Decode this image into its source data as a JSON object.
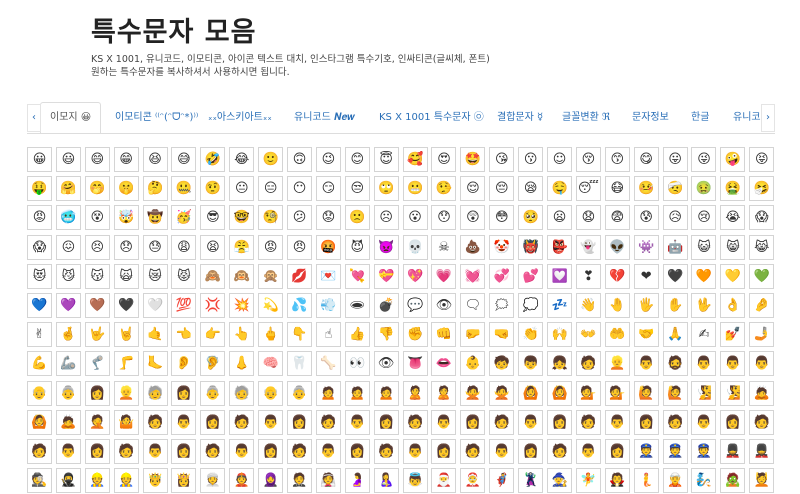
{
  "header": {
    "title": "특수문자 모음",
    "subtitle_line1": "KS X 1001, 유니코드, 이모티콘, 아이콘 텍스트 대치, 인스타그램 특수기호, 인싸티콘(글씨체, 폰트)",
    "subtitle_line2": "원하는 특수문자를 복사하셔서 사용하시면 됩니다."
  },
  "tabs": {
    "prev_arrow": "‹",
    "next_arrow": "›",
    "items": [
      {
        "label": "이모지 😀",
        "active": true
      },
      {
        "label": "이모티콘 ⁽⁽ᵔ(ᵔᗜᵔ*)⁾⁾",
        "active": false
      },
      {
        "label": "ₓₓ아스키아트ₓₓ",
        "active": false
      },
      {
        "label": "유니코드 𝑵𝒆𝒘",
        "active": false
      },
      {
        "label": "KS X 1001 특수문자 ㉧",
        "active": false
      },
      {
        "label": "결합문자 ☿",
        "active": false
      },
      {
        "label": "글꼴변환 ℜ",
        "active": false
      },
      {
        "label": "문자정보",
        "active": false
      },
      {
        "label": "한글",
        "active": false
      },
      {
        "label": "유니코",
        "active": false
      }
    ]
  },
  "emoji_grid": [
    "😀",
    "😃",
    "😄",
    "😁",
    "😆",
    "😅",
    "🤣",
    "😂",
    "🙂",
    "🙃",
    "😉",
    "😊",
    "😇",
    "🥰",
    "😍",
    "🤩",
    "😘",
    "😗",
    "☺",
    "😚",
    "😙",
    "😋",
    "😛",
    "😜",
    "🤪",
    "😝",
    "🤑",
    "🤗",
    "🤭",
    "🤫",
    "🤔",
    "🤐",
    "🤨",
    "😐",
    "😑",
    "😶",
    "😏",
    "😒",
    "🙄",
    "😬",
    "🤥",
    "😌",
    "😔",
    "😪",
    "🤤",
    "😴",
    "😷",
    "🤒",
    "🤕",
    "🤢",
    "🤮",
    "🤧",
    "😡",
    "🥶",
    "😵",
    "🤯",
    "🤠",
    "🥳",
    "😎",
    "🤓",
    "🧐",
    "😕",
    "😟",
    "🙁",
    "☹",
    "😮",
    "😯",
    "😲",
    "😳",
    "🥺",
    "😦",
    "😧",
    "😨",
    "😰",
    "😥",
    "😢",
    "😭",
    "😱",
    "😱",
    "😖",
    "😣",
    "😞",
    "😓",
    "😩",
    "😫",
    "😤",
    "😡",
    "😠",
    "🤬",
    "😈",
    "👿",
    "💀",
    "☠",
    "💩",
    "🤡",
    "👹",
    "👺",
    "👻",
    "👽",
    "👾",
    "🤖",
    "😺",
    "😸",
    "😹",
    "😻",
    "😼",
    "😽",
    "🙀",
    "😿",
    "😾",
    "🙈",
    "🙉",
    "🙊",
    "💋",
    "💌",
    "💘",
    "💝",
    "💖",
    "💗",
    "💓",
    "💞",
    "💕",
    "💟",
    "❣",
    "💔",
    "❤",
    "🖤",
    "🧡",
    "💛",
    "💚",
    "💙",
    "💜",
    "🤎",
    "🖤",
    "🤍",
    "💯",
    "💢",
    "💥",
    "💫",
    "💦",
    "💨",
    "🕳",
    "💣",
    "💬",
    "👁",
    "🗨",
    "🗯",
    "💭",
    "💤",
    "👋",
    "🤚",
    "🖐",
    "✋",
    "🖖",
    "👌",
    "🤌",
    "✌",
    "🤞",
    "🤟",
    "🤘",
    "🤙",
    "👈",
    "👉",
    "👆",
    "🖕",
    "👇",
    "☝",
    "👍",
    "👎",
    "✊",
    "👊",
    "🤛",
    "🤜",
    "👏",
    "🙌",
    "👐",
    "🤲",
    "🤝",
    "🙏",
    "✍",
    "💅",
    "🤳",
    "💪",
    "🦾",
    "🦿",
    "🦵",
    "🦶",
    "👂",
    "🦻",
    "👃",
    "🧠",
    "🦷",
    "🦴",
    "👀",
    "👁",
    "👅",
    "👄",
    "👶",
    "🧒",
    "👦",
    "👧",
    "🧑",
    "👱",
    "👨",
    "🧔",
    "👨",
    "👨",
    "👨",
    "👴",
    "👵",
    "👩",
    "👱",
    "🧓",
    "👩",
    "👵",
    "🧓",
    "👴",
    "👵",
    "🙍",
    "🙍",
    "🙍",
    "🙎",
    "🙎",
    "🙅",
    "🙅",
    "🙆",
    "🙆",
    "💁",
    "💁",
    "🙋",
    "🙋",
    "🧏",
    "🧏",
    "🙇",
    "🙆",
    "🙇",
    "🤦",
    "🤷",
    "🧑",
    "👨",
    "👩",
    "🧑",
    "👨",
    "👩",
    "🧑",
    "👨",
    "👩",
    "🧑",
    "👨",
    "👩",
    "🧑",
    "👨",
    "👩",
    "🧑",
    "👨",
    "👩",
    "🧑",
    "👨",
    "👩",
    "🧑",
    "🧑",
    "👨",
    "👩",
    "🧑",
    "👨",
    "👩",
    "🧑",
    "👨",
    "👩",
    "🧑",
    "👨",
    "👩",
    "🧑",
    "👨",
    "👩",
    "🧑",
    "👨",
    "👩",
    "🧑",
    "👨",
    "👩",
    "👮",
    "👮",
    "👮",
    "💂",
    "💂",
    "🕵",
    "🥷",
    "👷",
    "👷",
    "🤴",
    "👸",
    "👳",
    "👲",
    "🧕",
    "🤵",
    "👰",
    "🤰",
    "🤱",
    "👼",
    "🎅",
    "🤶",
    "🦸",
    "🦹",
    "🧙",
    "🧚",
    "🧛",
    "🧜",
    "🧝",
    "🧞",
    "🧟",
    "💆"
  ]
}
